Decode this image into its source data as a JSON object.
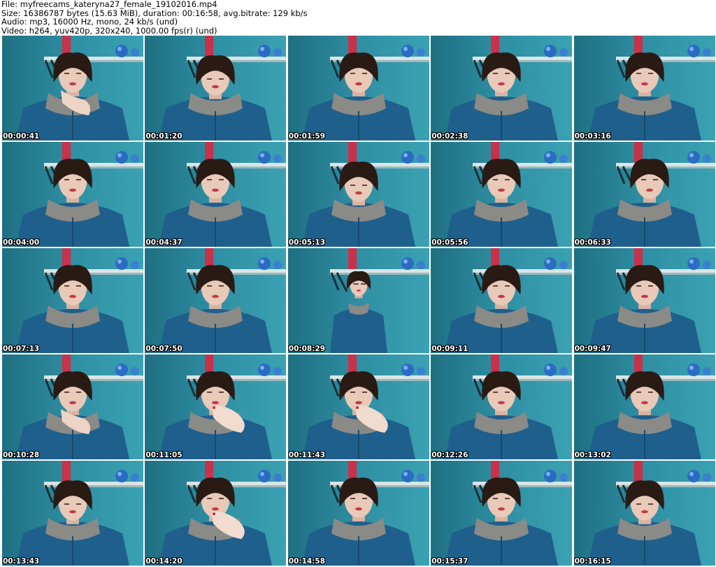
{
  "info": {
    "file_line": "File: myfreecams_kateryna27_female_19102016.mp4",
    "size_line": "Size: 16386787 bytes (15.63 MiB), duration: 00:16:58, avg.bitrate: 129 kb/s",
    "audio_line": "Audio: mp3, 16000 Hz, mono, 24 kb/s (und)",
    "video_line": "Video: h264, yuv420p, 320x240, 1000.00 fps(r) (und)"
  },
  "colors": {
    "wall": "#2f8fa3",
    "wall_dark": "#1f6f82",
    "sweater": "#1f5f8c",
    "hood": "#8a8a86",
    "hair": "#2a1a14",
    "skin": "#e9c9b8",
    "shelf": "#d8e6e6",
    "ball": "#2a6cc4",
    "red_item": "#c8324a"
  },
  "thumbnails": [
    {
      "time": "00:00:41",
      "variant": "hand-chin"
    },
    {
      "time": "00:01:20",
      "variant": "down"
    },
    {
      "time": "00:01:59",
      "variant": "front"
    },
    {
      "time": "00:02:38",
      "variant": "front"
    },
    {
      "time": "00:03:16",
      "variant": "front"
    },
    {
      "time": "00:04:00",
      "variant": "front"
    },
    {
      "time": "00:04:37",
      "variant": "front"
    },
    {
      "time": "00:05:13",
      "variant": "down"
    },
    {
      "time": "00:05:56",
      "variant": "front"
    },
    {
      "time": "00:06:33",
      "variant": "tilt"
    },
    {
      "time": "00:07:13",
      "variant": "front"
    },
    {
      "time": "00:07:50",
      "variant": "front"
    },
    {
      "time": "00:08:29",
      "variant": "far"
    },
    {
      "time": "00:09:11",
      "variant": "front"
    },
    {
      "time": "00:09:47",
      "variant": "front"
    },
    {
      "time": "00:10:28",
      "variant": "hand-chin"
    },
    {
      "time": "00:11:05",
      "variant": "hand-mouth"
    },
    {
      "time": "00:11:43",
      "variant": "hand-mouth"
    },
    {
      "time": "00:12:26",
      "variant": "front"
    },
    {
      "time": "00:13:02",
      "variant": "front"
    },
    {
      "time": "00:13:43",
      "variant": "down"
    },
    {
      "time": "00:14:20",
      "variant": "hand-mouth"
    },
    {
      "time": "00:14:58",
      "variant": "front"
    },
    {
      "time": "00:15:37",
      "variant": "front"
    },
    {
      "time": "00:16:15",
      "variant": "down"
    }
  ]
}
